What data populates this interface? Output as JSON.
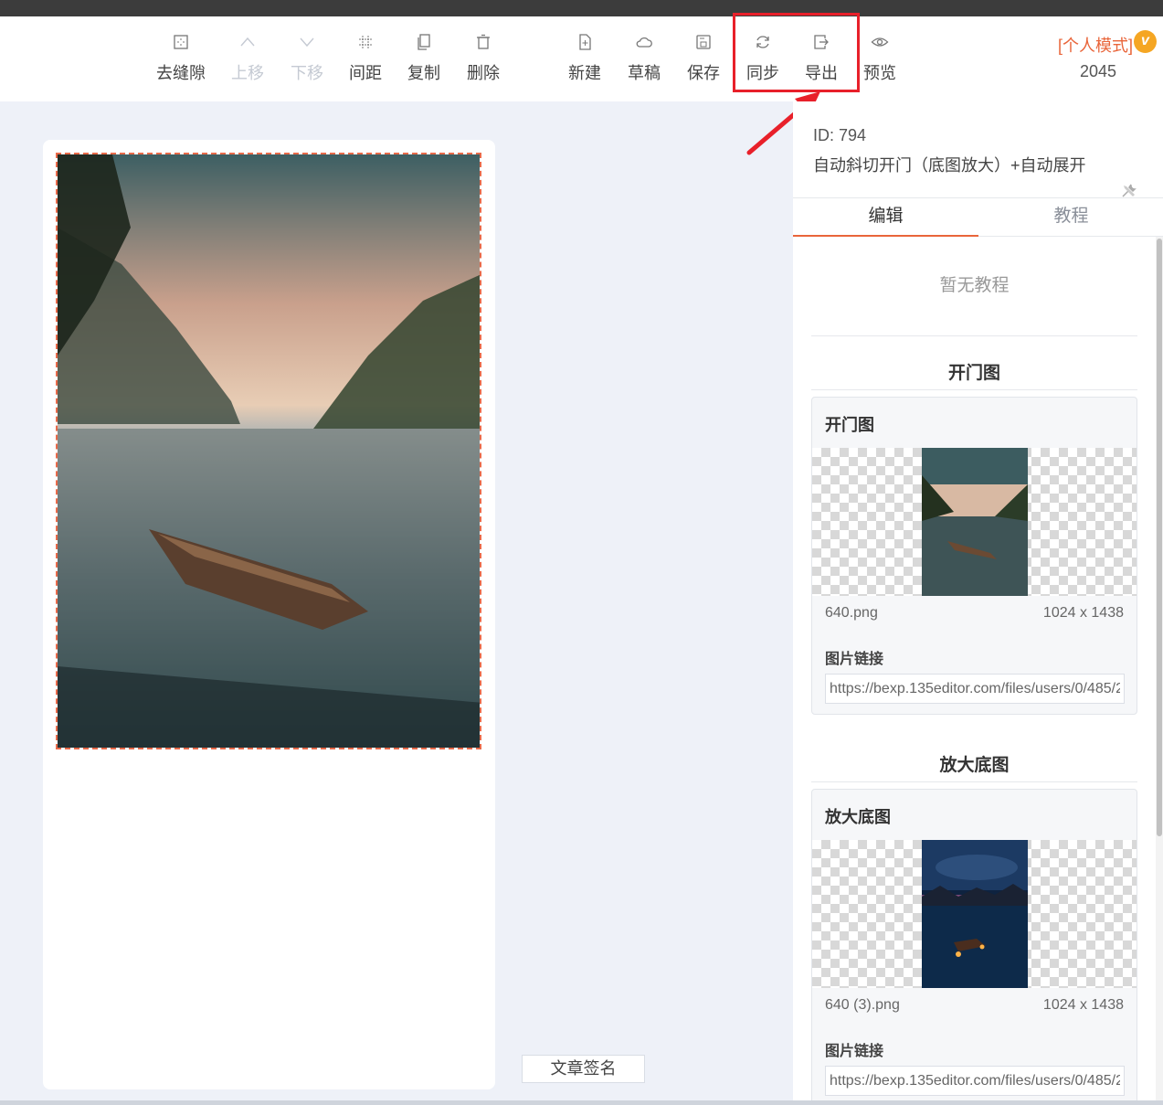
{
  "toolbar": {
    "items": [
      {
        "label": "去缝隙",
        "icon": "remove-gap-icon",
        "disabled": false
      },
      {
        "label": "上移",
        "icon": "chevron-up-icon",
        "disabled": true
      },
      {
        "label": "下移",
        "icon": "chevron-down-icon",
        "disabled": true
      },
      {
        "label": "间距",
        "icon": "spacing-icon",
        "disabled": false
      },
      {
        "label": "复制",
        "icon": "copy-icon",
        "disabled": false
      },
      {
        "label": "删除",
        "icon": "trash-icon",
        "disabled": false
      },
      {
        "label": "新建",
        "icon": "new-file-icon",
        "disabled": false
      },
      {
        "label": "草稿",
        "icon": "cloud-icon",
        "disabled": false
      },
      {
        "label": "保存",
        "icon": "save-icon",
        "disabled": false
      },
      {
        "label": "同步",
        "icon": "refresh-icon",
        "disabled": false
      },
      {
        "label": "导出",
        "icon": "export-icon",
        "disabled": false
      },
      {
        "label": "预览",
        "icon": "eye-icon",
        "disabled": false
      }
    ],
    "mode_label": "[个人模式]",
    "vip_badge": "v",
    "count": "2045"
  },
  "canvas": {
    "signature_button": "文章签名"
  },
  "panel": {
    "id_text": "ID: 794",
    "template_name": "自动斜切开门（底图放大）+自动展开",
    "tabs": [
      "编辑",
      "教程"
    ],
    "active_tab": "编辑",
    "empty_tutorial": "暂无教程",
    "sections": [
      {
        "title": "开门图",
        "card_title": "开门图",
        "file_name": "640.png",
        "file_size": "1024 x 1438",
        "link_label": "图片链接",
        "link_value": "https://bexp.135editor.com/files/users/0/485/2"
      },
      {
        "title": "放大底图",
        "card_title": "放大底图",
        "file_name": "640 (3).png",
        "file_size": "1024 x 1438",
        "link_label": "图片链接",
        "link_value": "https://bexp.135editor.com/files/users/0/485/2"
      }
    ]
  },
  "colors": {
    "accent": "#e9653a",
    "highlight": "#e8202a",
    "vip": "#f5a623"
  }
}
